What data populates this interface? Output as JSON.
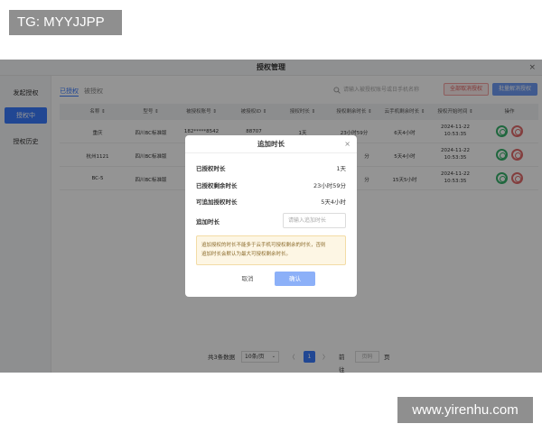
{
  "overlay_labels": {
    "top_left": "TG: MYYJJPP",
    "bottom_right": "www.yirenhu.com"
  },
  "window": {
    "title": "授权管理",
    "close": "×"
  },
  "sidebar": {
    "items": [
      {
        "label": "发起授权",
        "active": false
      },
      {
        "label": "授权中",
        "active": true
      },
      {
        "label": "授权历史",
        "active": false
      }
    ]
  },
  "tabs": [
    {
      "label": "已授权",
      "active": true
    },
    {
      "label": "被授权",
      "active": false
    }
  ],
  "toolbar": {
    "search_placeholder": "请输入被授权账号或日手机名称",
    "cancel_all_label": "全部取消授权",
    "unbind_label": "批量解消授权"
  },
  "table": {
    "columns": [
      "名称 ⇕",
      "型号 ⇕",
      "被授权账号 ⇕",
      "被授权ID ⇕",
      "授权时长 ⇕",
      "授权剩余时长 ⇕",
      "云手机剩余时长 ⇕",
      "授权开始时间 ⇕",
      "操作"
    ],
    "rows": [
      {
        "name": "重庆",
        "model": "四川BC标准版",
        "account": "182*****8542",
        "id": "88707",
        "duration": "1天",
        "remaining": "23小时59分",
        "phone_remaining": "6天4小时",
        "start_date": "2024-11-22",
        "start_time": "10:53:35"
      },
      {
        "name": "杭州1121",
        "model": "四川BC标准版",
        "account": "",
        "id": "",
        "duration": "",
        "remaining": "分",
        "phone_remaining": "5天4小时",
        "start_date": "2024-11-22",
        "start_time": "10:53:35"
      },
      {
        "name": "BC-5",
        "model": "四川BC标准版",
        "account": "",
        "id": "",
        "duration": "",
        "remaining": "分",
        "phone_remaining": "15天5小时",
        "start_date": "2024-11-22",
        "start_time": "10:53:35"
      }
    ]
  },
  "pagination": {
    "total": "共3条数据",
    "page_size": "10条/页",
    "prev": "〈",
    "current_page": "1",
    "next": "〉",
    "goto_label": "前往",
    "goto_placeholder": "页码",
    "page_unit": "页"
  },
  "modal": {
    "title": "追加时长",
    "close": "×",
    "rows": [
      {
        "label": "已授权时长",
        "value": "1天"
      },
      {
        "label": "已授权剩余时长",
        "value": "23小时59分"
      },
      {
        "label": "可追加授权时长",
        "value": "5天4小时"
      }
    ],
    "input_label": "追加时长",
    "input_placeholder": "请输入追加时长",
    "warning_line1": "追加授权的时长不能多于云手机可授权剩余的时长，否则",
    "warning_line2": "追加时长会默认为最大可授权剩余时长。",
    "cancel_label": "取消",
    "ok_label": "确认"
  },
  "colors": {
    "accent": "#3a7bfd",
    "overlay": "rgba(0,0,0,0.42)",
    "warning_bg": "#fdf6e4",
    "success": "#37b26c",
    "danger": "#e26b6b"
  }
}
